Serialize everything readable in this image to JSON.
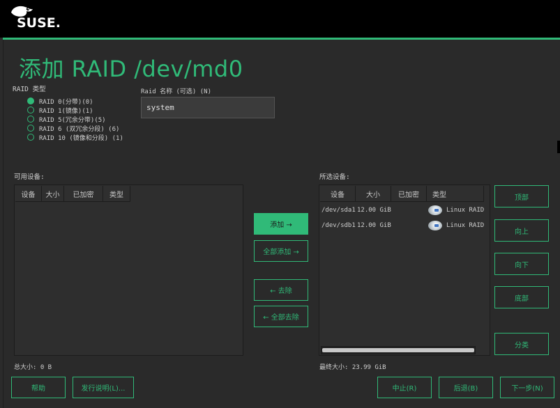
{
  "brand": {
    "name": "SUSE."
  },
  "page": {
    "title": "添加 RAID /dev/md0"
  },
  "raid_type": {
    "label": "RAID 类型",
    "options": [
      {
        "label": "RAID 0(分带)(0)",
        "selected": true
      },
      {
        "label": "RAID 1(镜像)(1)",
        "selected": false
      },
      {
        "label": "RAID 5(冗余分带)(5)",
        "selected": false
      },
      {
        "label": "RAID 6 (双冗余分段) (6)",
        "selected": false
      },
      {
        "label": "RAID 10 (镜像和分段) (1)",
        "selected": false
      }
    ]
  },
  "raid_name": {
    "label": "Raid 名称 (可选) (N)",
    "value": "system"
  },
  "available": {
    "label": "可用设备:",
    "columns": [
      "设备",
      "大小",
      "已加密",
      "类型"
    ],
    "rows": [],
    "total": "总大小: 0 B"
  },
  "selected": {
    "label": "所选设备:",
    "columns": [
      "设备",
      "大小",
      "已加密",
      "类型"
    ],
    "rows": [
      {
        "device": "/dev/sda1",
        "size": "12.00 GiB",
        "encrypted": "",
        "type": "Linux RAID"
      },
      {
        "device": "/dev/sdb1",
        "size": "12.00 GiB",
        "encrypted": "",
        "type": "Linux RAID"
      }
    ],
    "total": "最终大小: 23.99 GiB"
  },
  "actions": {
    "add": "添加 →",
    "add_all": "全部添加 →",
    "remove": "← 去除",
    "remove_all": "← 全部去除"
  },
  "order": {
    "top": "顶部",
    "up": "向上",
    "down": "向下",
    "bottom": "底部",
    "classify": "分类"
  },
  "footer": {
    "help": "帮助",
    "release_notes": "发行说明(L)...",
    "abort": "中止(R)",
    "back": "后退(B)",
    "next": "下一步(N)"
  },
  "colors": {
    "accent": "#30ba78",
    "background": "#2b2b2b",
    "header": "#000000"
  }
}
